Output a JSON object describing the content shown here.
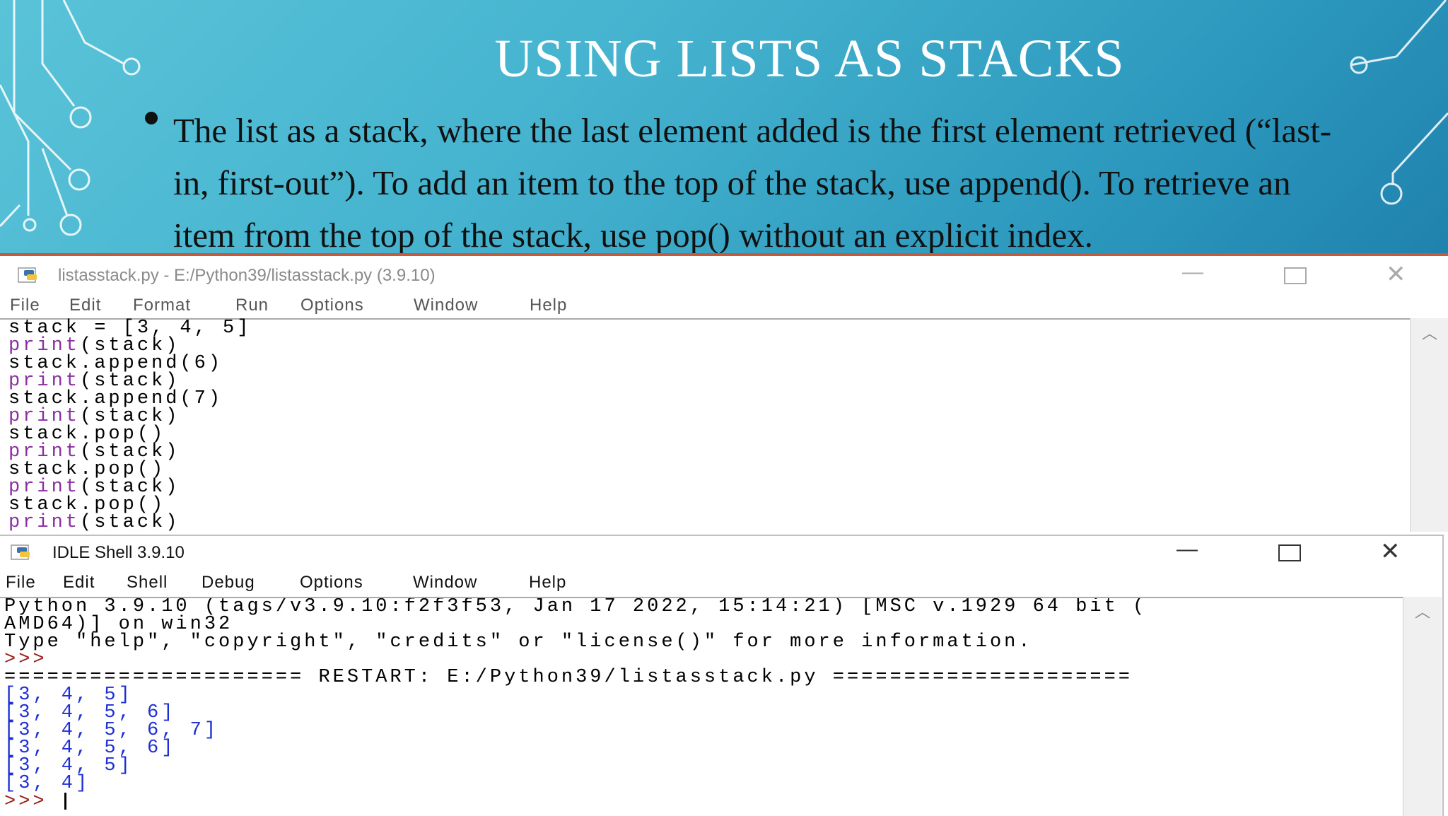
{
  "slide": {
    "title": "USING LISTS AS STACKS",
    "bullet": "The list as a stack, where the last element added is the first element retrieved (“last-in, first-out”). To add an item to the top of the stack, use append(). To retrieve an item from the top of the stack, use pop() without an explicit index."
  },
  "editor": {
    "title": "listasstack.py - E:/Python39/listasstack.py (3.9.10)",
    "icon": "python-file-icon",
    "menu": [
      "File",
      "Edit",
      "Format",
      "Run",
      "Options",
      "Window",
      "Help"
    ],
    "code": [
      {
        "text": "stack = [3, 4, 5]",
        "kind": "plain"
      },
      {
        "kw": "print",
        "rest": "(stack)"
      },
      {
        "text": "stack.append(6)",
        "kind": "plain"
      },
      {
        "kw": "print",
        "rest": "(stack)"
      },
      {
        "text": "stack.append(7)",
        "kind": "plain"
      },
      {
        "kw": "print",
        "rest": "(stack)"
      },
      {
        "text": "stack.pop()",
        "kind": "plain"
      },
      {
        "kw": "print",
        "rest": "(stack)"
      },
      {
        "text": "stack.pop()",
        "kind": "plain"
      },
      {
        "kw": "print",
        "rest": "(stack)"
      },
      {
        "text": "stack.pop()",
        "kind": "plain"
      },
      {
        "kw": "print",
        "rest": "(stack)"
      }
    ]
  },
  "shell": {
    "title": "IDLE Shell 3.9.10",
    "icon": "python-shell-icon",
    "menu": [
      "File",
      "Edit",
      "Shell",
      "Debug",
      "Options",
      "Window",
      "Help"
    ],
    "banner": [
      "Python 3.9.10 (tags/v3.9.10:f2f3f53, Jan 17 2022, 15:14:21) [MSC v.1929 64 bit (",
      "AMD64)] on win32",
      "Type \"help\", \"copyright\", \"credits\" or \"license()\" for more information."
    ],
    "prompt": ">>>",
    "restart": "===================== RESTART: E:/Python39/listasstack.py =====================",
    "output": [
      "[3, 4, 5]",
      "[3, 4, 5, 6]",
      "[3, 4, 5, 6, 7]",
      "[3, 4, 5, 6]",
      "[3, 4, 5]",
      "[3, 4]"
    ],
    "final_prompt": ">>> "
  },
  "colors": {
    "keyword": "#8b2fa2",
    "output": "#1f2fd8",
    "prompt": "#9b1f1f",
    "slide_bg": "#45b3cf"
  }
}
